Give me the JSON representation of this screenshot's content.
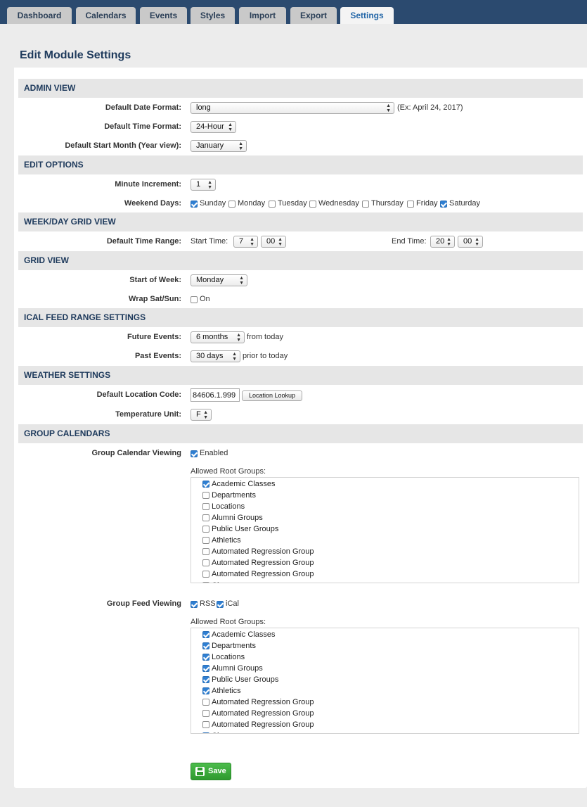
{
  "tabs": [
    "Dashboard",
    "Calendars",
    "Events",
    "Styles",
    "Import",
    "Export",
    "Settings"
  ],
  "active_tab": "Settings",
  "page_title": "Edit Module Settings",
  "sections": {
    "admin_view": "ADMIN VIEW",
    "edit_options": "EDIT OPTIONS",
    "week_day_grid": "WEEK/DAY GRID VIEW",
    "grid_view": "GRID VIEW",
    "ical_feed": "ICAL FEED RANGE SETTINGS",
    "weather": "WEATHER SETTINGS",
    "group_calendars": "GROUP CALENDARS"
  },
  "admin_view": {
    "date_format_label": "Default Date Format:",
    "date_format_value": "long",
    "date_format_example": "(Ex: April 24, 2017)",
    "time_format_label": "Default Time Format:",
    "time_format_value": "24-Hour",
    "start_month_label": "Default Start Month (Year view):",
    "start_month_value": "January"
  },
  "edit_options": {
    "minute_increment_label": "Minute Increment:",
    "minute_increment_value": "1",
    "weekend_days_label": "Weekend Days:",
    "days": [
      {
        "name": "Sunday",
        "checked": true
      },
      {
        "name": "Monday",
        "checked": false
      },
      {
        "name": "Tuesday",
        "checked": false
      },
      {
        "name": "Wednesday",
        "checked": false
      },
      {
        "name": "Thursday",
        "checked": false
      },
      {
        "name": "Friday",
        "checked": false
      },
      {
        "name": "Saturday",
        "checked": true
      }
    ]
  },
  "week_day_grid": {
    "time_range_label": "Default Time Range:",
    "start_time_label": "Start Time:",
    "start_hour": "7",
    "start_minute": "00",
    "end_time_label": "End Time:",
    "end_hour": "20",
    "end_minute": "00"
  },
  "grid_view": {
    "start_of_week_label": "Start of Week:",
    "start_of_week_value": "Monday",
    "wrap_label": "Wrap Sat/Sun:",
    "wrap_on_label": "On",
    "wrap_checked": false
  },
  "ical_feed": {
    "future_label": "Future Events:",
    "future_value": "6 months",
    "future_suffix": "from today",
    "past_label": "Past Events:",
    "past_value": "30 days",
    "past_suffix": "prior to today"
  },
  "weather": {
    "location_label": "Default Location Code:",
    "location_value": "84606.1.999",
    "lookup_button": "Location Lookup",
    "temp_unit_label": "Temperature Unit:",
    "temp_unit_value": "F"
  },
  "group_calendars": {
    "viewing_label": "Group Calendar Viewing",
    "enabled_label": "Enabled",
    "enabled_checked": true,
    "allowed_label": "Allowed Root Groups:",
    "groups": [
      {
        "name": "Academic Classes",
        "checked": true
      },
      {
        "name": "Departments",
        "checked": false
      },
      {
        "name": "Locations",
        "checked": false
      },
      {
        "name": "Alumni Groups",
        "checked": false
      },
      {
        "name": "Public User Groups",
        "checked": false
      },
      {
        "name": "Athletics",
        "checked": false
      },
      {
        "name": "Automated Regression Group",
        "checked": false
      },
      {
        "name": "Automated Regression Group",
        "checked": false
      },
      {
        "name": "Automated Regression Group",
        "checked": false
      },
      {
        "name": "Cl",
        "checked": false
      }
    ],
    "feed_label": "Group Feed Viewing",
    "rss_label": "RSS",
    "rss_checked": true,
    "ical_label": "iCal",
    "ical_checked": true,
    "feed_allowed_label": "Allowed Root Groups:",
    "feed_groups": [
      {
        "name": "Academic Classes",
        "checked": true
      },
      {
        "name": "Departments",
        "checked": true
      },
      {
        "name": "Locations",
        "checked": true
      },
      {
        "name": "Alumni Groups",
        "checked": true
      },
      {
        "name": "Public User Groups",
        "checked": true
      },
      {
        "name": "Athletics",
        "checked": true
      },
      {
        "name": "Automated Regression Group",
        "checked": false
      },
      {
        "name": "Automated Regression Group",
        "checked": false
      },
      {
        "name": "Automated Regression Group",
        "checked": false
      },
      {
        "name": "Cl",
        "checked": true
      }
    ]
  },
  "save_label": "Save",
  "colors": {
    "topbar": "#2b4a6f",
    "active_tab_text": "#2467a8",
    "section_title": "#1e3a5c",
    "checkbox_checked": "#2f7fd2",
    "save_button": "#3aa83a"
  }
}
